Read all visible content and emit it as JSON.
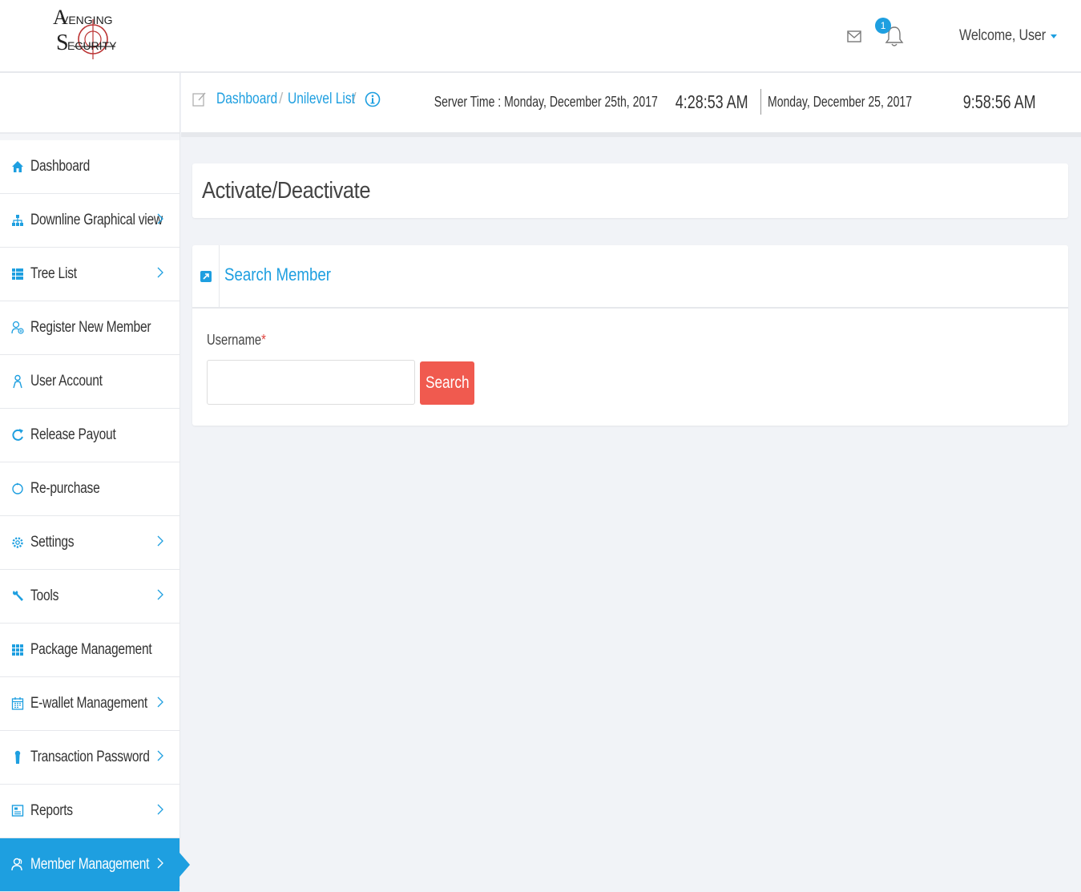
{
  "brand": {
    "logo_line1": "VENGING",
    "logo_a": "A",
    "logo_line2": "ECURITY",
    "logo_s": "S"
  },
  "header": {
    "notification_count": "1",
    "welcome": "Welcome, User"
  },
  "breadcrumb": {
    "items": [
      "Dashboard",
      "Unilevel List"
    ],
    "separator": "/"
  },
  "server_time": {
    "label": "Server Time : Monday, December 25th, 2017",
    "time": "4:28:53 AM",
    "local_date": "Monday, December 25, 2017",
    "local_time": "9:58:56 AM"
  },
  "sidebar": {
    "items": [
      {
        "label": "Dashboard",
        "icon": "home-icon"
      },
      {
        "label": "Downline Graphical view",
        "icon": "sitemap-icon"
      },
      {
        "label": "Tree List",
        "icon": "list-icon"
      },
      {
        "label": "Register New Member",
        "icon": "user-add-icon"
      },
      {
        "label": "User Account",
        "icon": "user-icon"
      },
      {
        "label": "Release Payout",
        "icon": "refresh-icon"
      },
      {
        "label": "Re-purchase",
        "icon": "circle-icon"
      },
      {
        "label": "Settings",
        "icon": "gear-icon"
      },
      {
        "label": "Tools",
        "icon": "wrench-icon"
      },
      {
        "label": "Package Management",
        "icon": "grid-icon"
      },
      {
        "label": "E-wallet Management",
        "icon": "calendar-icon"
      },
      {
        "label": "Transaction Password",
        "icon": "keyhole-icon"
      },
      {
        "label": "Reports",
        "icon": "report-icon"
      },
      {
        "label": "Member Management",
        "icon": "users-icon"
      }
    ]
  },
  "page": {
    "title": "Activate/Deactivate",
    "panel_title": "Search Member",
    "username_label": "Username",
    "required_mark": "*",
    "username_value": "",
    "search_button": "Search"
  },
  "colors": {
    "accent": "#1e9fe0",
    "danger": "#f05a4f",
    "background": "#f1f3f7"
  }
}
